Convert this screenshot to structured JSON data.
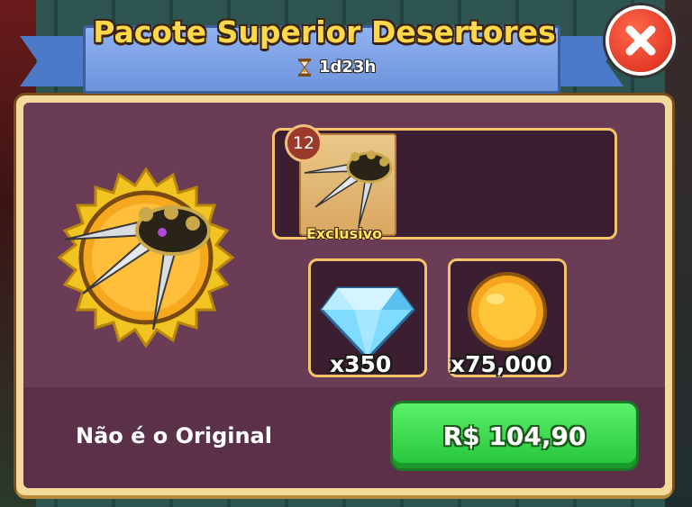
{
  "header": {
    "title": "Pacote Superior Desertores",
    "timer": "1d23h",
    "timer_icon": "hourglass-icon",
    "close_icon": "close-icon"
  },
  "rewards": {
    "main_item": {
      "icon": "claw-weapon-icon",
      "level": "12",
      "tag": "Exclusivo"
    },
    "gems": {
      "icon": "diamond-icon",
      "quantity": "x350"
    },
    "coins": {
      "icon": "gold-coin-icon",
      "quantity": "x75,000"
    }
  },
  "footer": {
    "notice": "Não é o Original",
    "buy_label": "R$ 104,90"
  },
  "colors": {
    "title": "#ffd84a",
    "ribbon": "#6d93dc",
    "panel": "#6a3c56",
    "buy": "#23c43a",
    "close": "#d8261a"
  }
}
